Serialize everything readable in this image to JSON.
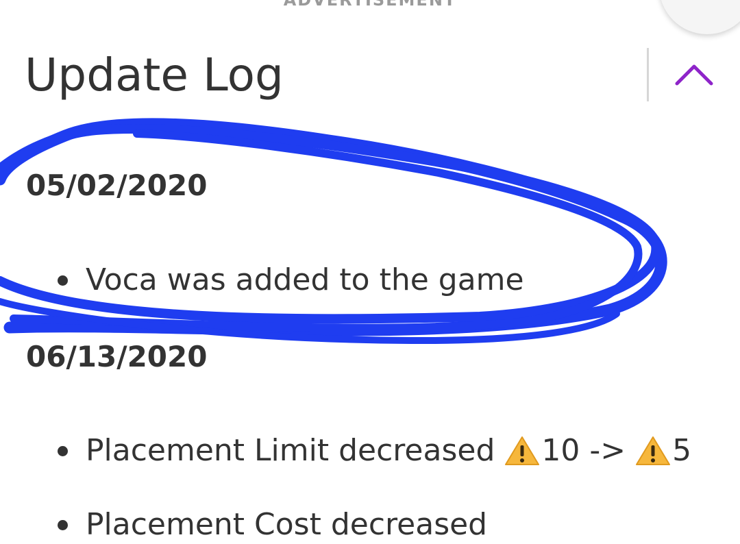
{
  "ad": {
    "label": "ADVERTISEMENT"
  },
  "section": {
    "title": "Update Log"
  },
  "log": {
    "entries": [
      {
        "date": "05/02/2020",
        "items": [
          "Voca was added to the game"
        ]
      },
      {
        "date": "06/13/2020",
        "items": [
          {
            "text": "Placement Limit decreased",
            "before": "10",
            "arrow": "->",
            "after": "5",
            "icon": "warning-icon"
          }
        ],
        "cut_off_item": "Placement Cost decreased"
      }
    ]
  },
  "colors": {
    "accent": "#8e24c9",
    "annotation": "#1f3df0",
    "text": "#333333"
  }
}
